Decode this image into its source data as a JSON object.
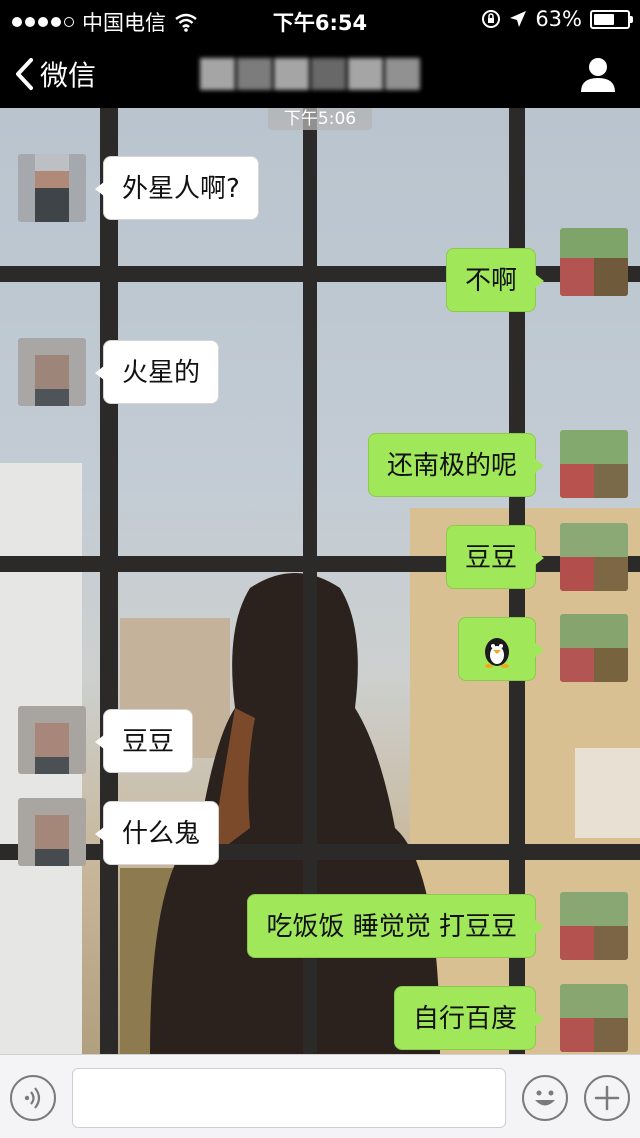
{
  "status_bar": {
    "carrier": "中国电信",
    "time": "下午6:54",
    "battery": "63%",
    "battery_level": 0.63
  },
  "nav": {
    "back_label": "微信"
  },
  "chat": {
    "timestamp": "下午5:06",
    "messages": [
      {
        "side": "left",
        "text": "外星人啊?"
      },
      {
        "side": "right",
        "text": "不啊"
      },
      {
        "side": "left",
        "text": "火星的"
      },
      {
        "side": "right",
        "text": "还南极的呢"
      },
      {
        "side": "right",
        "text": "豆豆"
      },
      {
        "side": "right",
        "text": "",
        "icon": "penguin-icon"
      },
      {
        "side": "left",
        "text": "豆豆"
      },
      {
        "side": "left",
        "text": "什么鬼"
      },
      {
        "side": "right",
        "text": "吃饭饭 睡觉觉 打豆豆"
      },
      {
        "side": "right",
        "text": "自行百度"
      }
    ]
  },
  "colors": {
    "bubble_self": "#a0e75a",
    "bubble_other": "#ffffff",
    "bar_background": "#000000"
  },
  "icons": [
    "signal-dots-icon",
    "wifi-icon",
    "lock-rotation-icon",
    "location-arrow-icon",
    "battery-icon",
    "chevron-left-icon",
    "person-icon",
    "voice-icon",
    "emoji-icon",
    "plus-icon",
    "penguin-icon"
  ]
}
